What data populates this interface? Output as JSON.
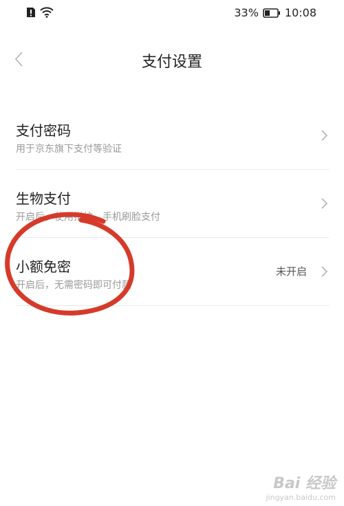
{
  "status_bar": {
    "battery_percent": "33%",
    "time": "10:08"
  },
  "header": {
    "title": "支付设置"
  },
  "rows": [
    {
      "title": "支付密码",
      "desc": "用于京东旗下支付等验证",
      "value": ""
    },
    {
      "title": "生物支付",
      "desc": "开启后，使用指纹、手机刷脸支付",
      "value": ""
    },
    {
      "title": "小额免密",
      "desc": "开启后，无需密码即可付款",
      "value": "未开启"
    }
  ],
  "annotation": {
    "color": "#d63a2a"
  },
  "watermark": {
    "logo": "Bai 经验",
    "url": "jingyan.baidu.com"
  }
}
